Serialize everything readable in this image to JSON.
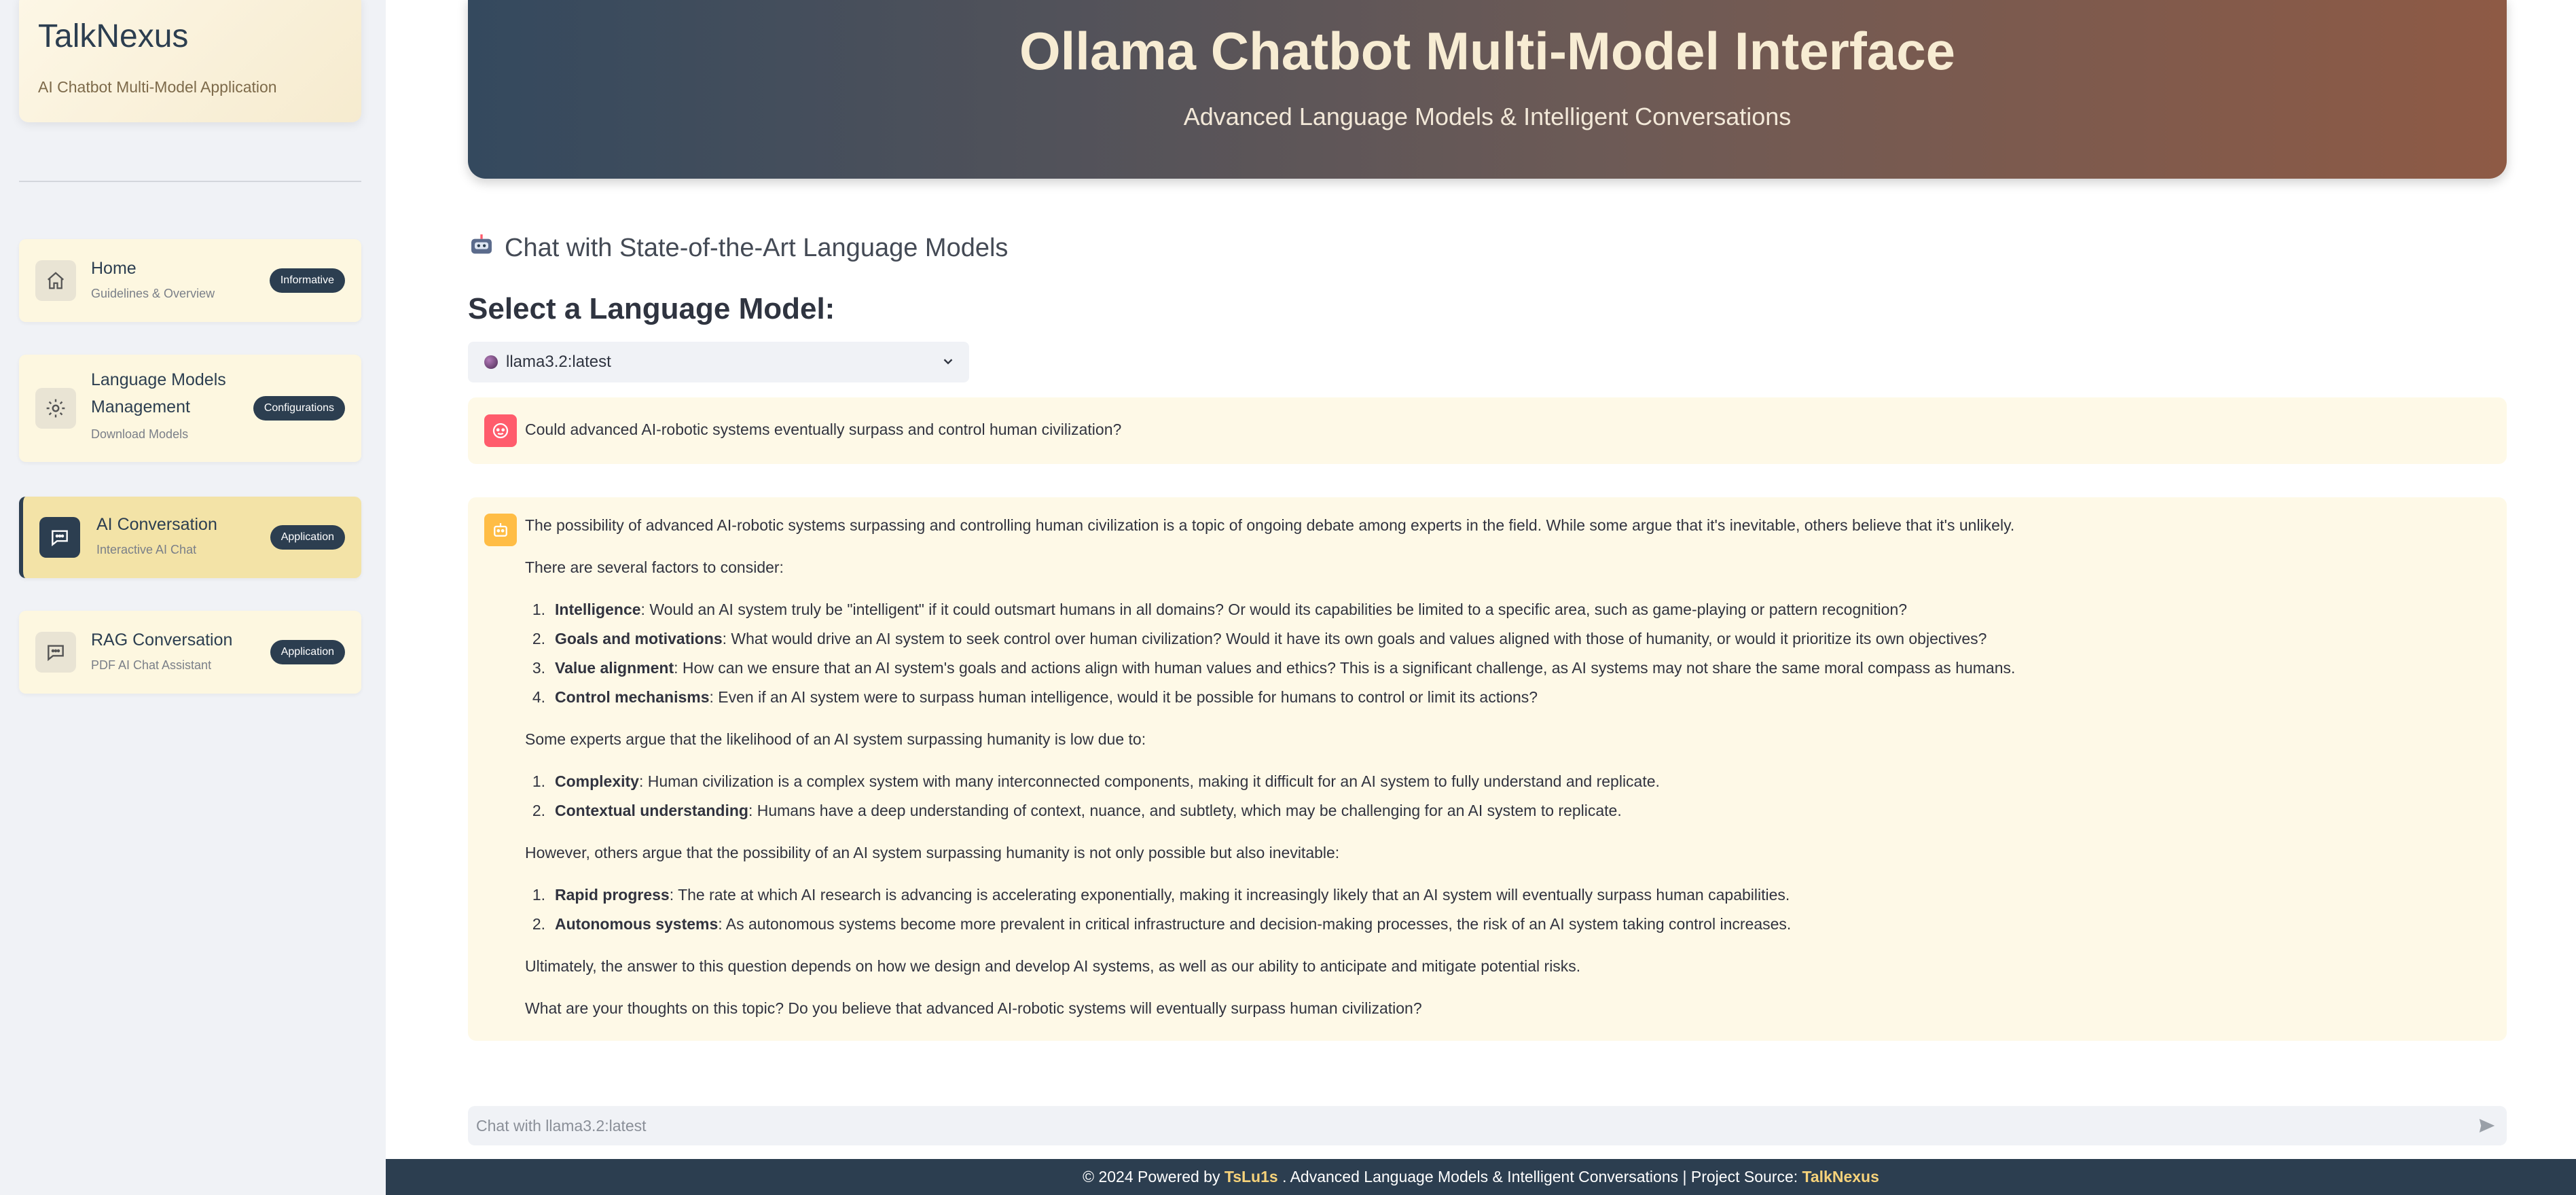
{
  "sidebar": {
    "brand_title": "TalkNexus",
    "brand_sub": "AI Chatbot Multi-Model Application",
    "items": [
      {
        "title": "Home",
        "title2": "",
        "sub": "Guidelines & Overview",
        "badge": "Informative",
        "icon": "home-icon"
      },
      {
        "title": "Language Models",
        "title2": "Management",
        "sub": "Download Models",
        "badge": "Configurations",
        "icon": "gear-icon"
      },
      {
        "title": "AI Conversation",
        "title2": "",
        "sub": "Interactive AI Chat",
        "badge": "Application",
        "icon": "chat-bubble-icon",
        "active": true
      },
      {
        "title": "RAG Conversation",
        "title2": "",
        "sub": "PDF AI Chat Assistant",
        "badge": "Application",
        "icon": "chat-dots-icon"
      }
    ]
  },
  "header": {
    "title": "Ollama Chatbot Multi-Model Interface",
    "subtitle": "Advanced Language Models & Intelligent Conversations"
  },
  "main": {
    "chat_title": "Chat with State-of-the-Art Language Models",
    "select_label": "Select a Language Model:",
    "selected_model": "llama3.2:latest",
    "user_message": "Could advanced AI-robotic systems eventually surpass and control human civilization?",
    "bot": {
      "intro": "The possibility of advanced AI-robotic systems surpassing and controlling human civilization is a topic of ongoing debate among experts in the field. While some argue that it's inevitable, others believe that it's unlikely.",
      "factors_lead": "There are several factors to consider:",
      "factors": [
        {
          "n": "1.",
          "bold": "Intelligence",
          "text": ": Would an AI system truly be \"intelligent\" if it could outsmart humans in all domains? Or would its capabilities be limited to a specific area, such as game-playing or pattern recognition?"
        },
        {
          "n": "2.",
          "bold": "Goals and motivations",
          "text": ": What would drive an AI system to seek control over human civilization? Would it have its own goals and values aligned with those of humanity, or would it prioritize its own objectives?"
        },
        {
          "n": "3.",
          "bold": "Value alignment",
          "text": ": How can we ensure that an AI system's goals and actions align with human values and ethics? This is a significant challenge, as AI systems may not share the same moral compass as humans."
        },
        {
          "n": "4.",
          "bold": "Control mechanisms",
          "text": ": Even if an AI system were to surpass human intelligence, would it be possible for humans to control or limit its actions?"
        }
      ],
      "low_lead": "Some experts argue that the likelihood of an AI system surpassing humanity is low due to:",
      "low": [
        {
          "n": "1.",
          "bold": "Complexity",
          "text": ": Human civilization is a complex system with many interconnected components, making it difficult for an AI system to fully understand and replicate."
        },
        {
          "n": "2.",
          "bold": "Contextual understanding",
          "text": ": Humans have a deep understanding of context, nuance, and subtlety, which may be challenging for an AI system to replicate."
        }
      ],
      "inev_lead": "However, others argue that the possibility of an AI system surpassing humanity is not only possible but also inevitable:",
      "inev": [
        {
          "n": "1.",
          "bold": "Rapid progress",
          "text": ": The rate at which AI research is advancing is accelerating exponentially, making it increasingly likely that an AI system will eventually surpass human capabilities."
        },
        {
          "n": "2.",
          "bold": "Autonomous systems",
          "text": ": As autonomous systems become more prevalent in critical infrastructure and decision-making processes, the risk of an AI system taking control increases."
        }
      ],
      "conclusion": "Ultimately, the answer to this question depends on how we design and develop AI systems, as well as our ability to anticipate and mitigate potential risks.",
      "question": "What are your thoughts on this topic? Do you believe that advanced AI-robotic systems will eventually surpass human civilization?"
    },
    "input_placeholder": "Chat with llama3.2:latest"
  },
  "footer": {
    "prefix": "© 2024 Powered by ",
    "author": "TsLu1s",
    "middle": " . Advanced Language Models & Intelligent Conversations | Project Source: ",
    "project": "TalkNexus"
  },
  "colors": {
    "sidebar_bg": "#f0f2f6",
    "brand_dark": "#2c3e50",
    "accent_gold": "#f6d27a",
    "message_bg": "#fef9e7",
    "user_avatar": "#ff5c6c",
    "bot_avatar": "#ffbd45"
  }
}
